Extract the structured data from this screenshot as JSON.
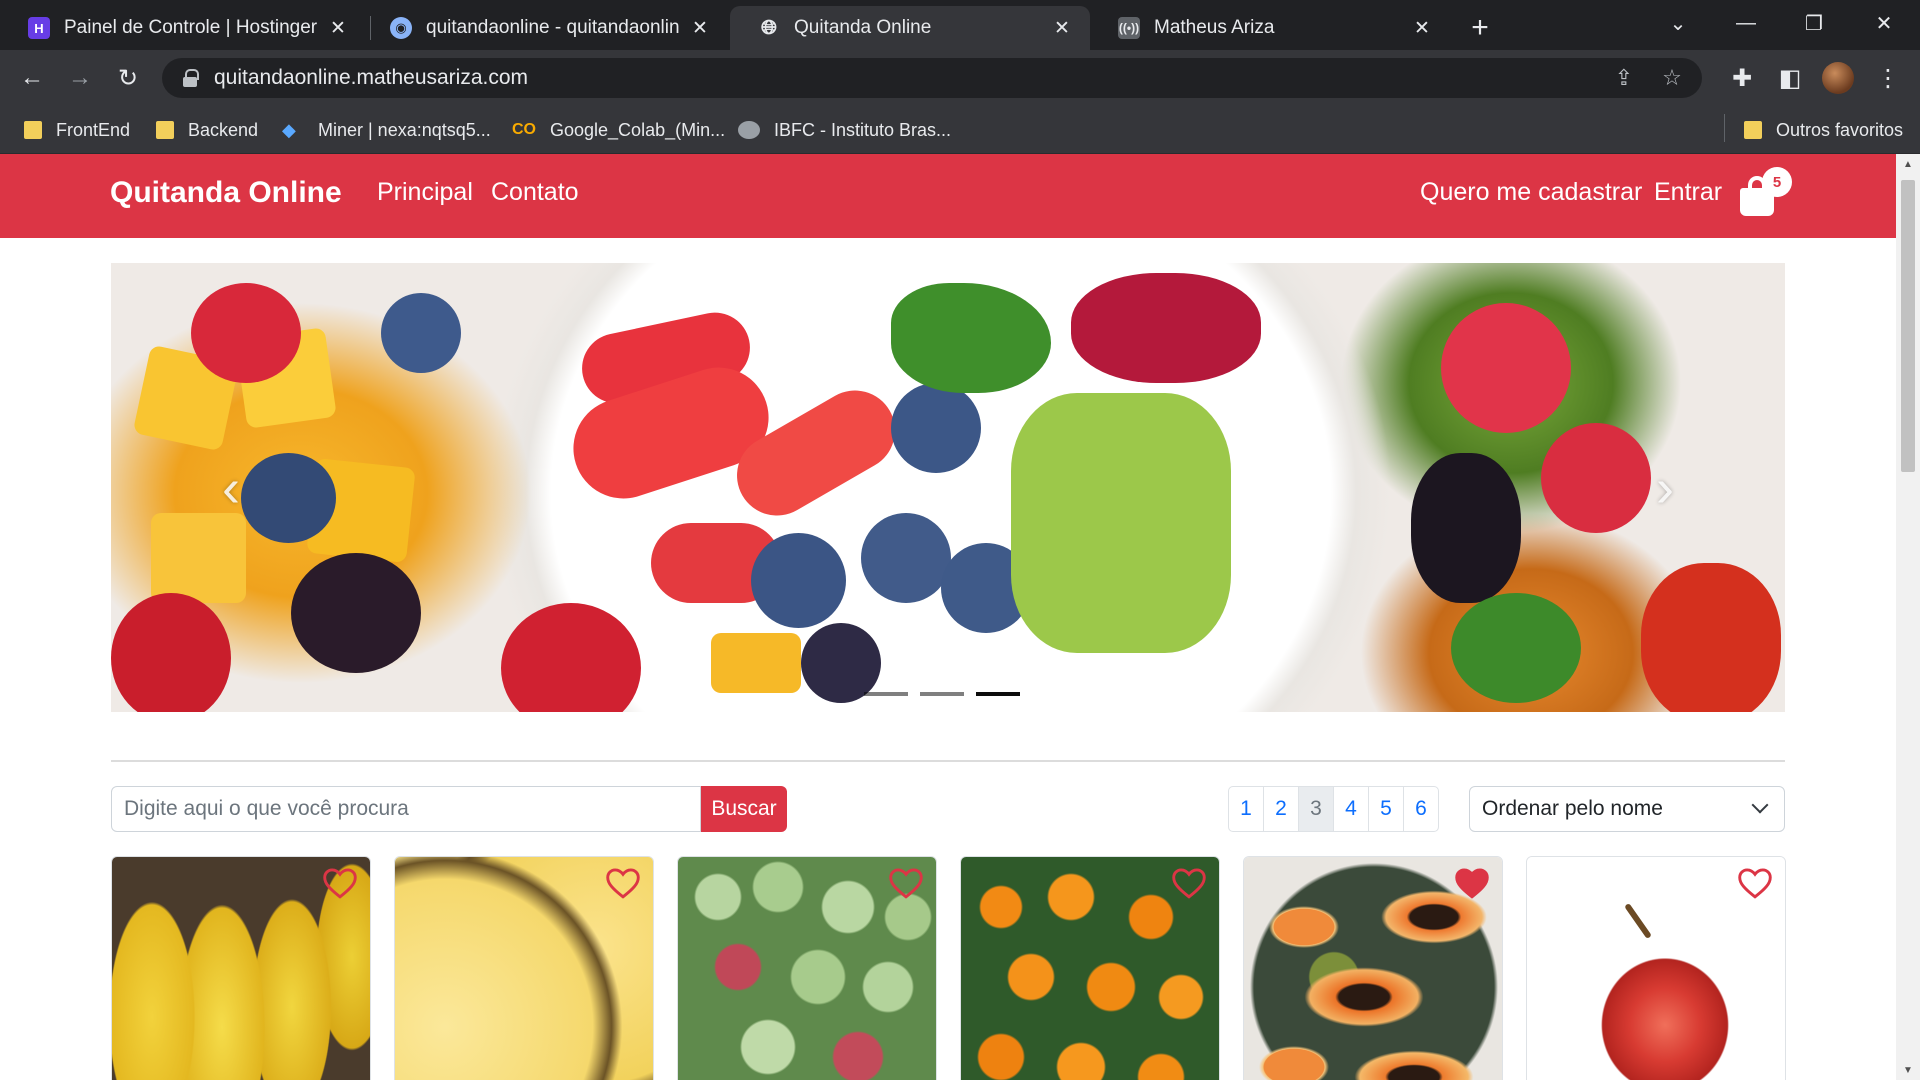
{
  "browser": {
    "tabs": [
      {
        "title": "Painel de Controle | Hostinger",
        "favicon": "hostinger-icon",
        "active": false
      },
      {
        "title": "quitandaonline - quitandaonline",
        "favicon": "database-icon",
        "active": false
      },
      {
        "title": "Quitanda Online",
        "favicon": "globe-icon",
        "active": true
      },
      {
        "title": "Matheus Ariza",
        "favicon": "broadcast-icon",
        "active": false
      }
    ],
    "url": "quitandaonline.matheusariza.com",
    "bookmarks": [
      {
        "label": "FrontEnd",
        "icon": "folder-icon"
      },
      {
        "label": "Backend",
        "icon": "folder-icon"
      },
      {
        "label": "Miner | nexa:nqtsq5...",
        "icon": "diamond-icon"
      },
      {
        "label": "Google_Colab_(Min...",
        "icon": "colab-icon"
      },
      {
        "label": "IBFC - Instituto Bras...",
        "icon": "ibfc-icon"
      }
    ],
    "other_bookmarks": "Outros favoritos"
  },
  "site": {
    "brand": "Quitanda Online",
    "nav": {
      "principal": "Principal",
      "contato": "Contato",
      "register": "Quero me cadastrar",
      "login": "Entrar"
    },
    "cart_count": "5",
    "accent_color": "#dc3545",
    "carousel": {
      "slides": 3,
      "active_slide": 3
    }
  },
  "search": {
    "placeholder": "Digite aqui o que você procura",
    "button": "Buscar"
  },
  "pagination": {
    "pages": [
      "1",
      "2",
      "3",
      "4",
      "5",
      "6"
    ],
    "active": "3"
  },
  "sort": {
    "selected": "Ordenar pelo nome"
  },
  "products": [
    {
      "image": "bananas",
      "favorited": false
    },
    {
      "image": "pineapple-slices",
      "favorited": false
    },
    {
      "image": "guavas",
      "favorited": false
    },
    {
      "image": "tangerines",
      "favorited": false
    },
    {
      "image": "papayas",
      "favorited": true
    },
    {
      "image": "apple",
      "favorited": false
    }
  ]
}
